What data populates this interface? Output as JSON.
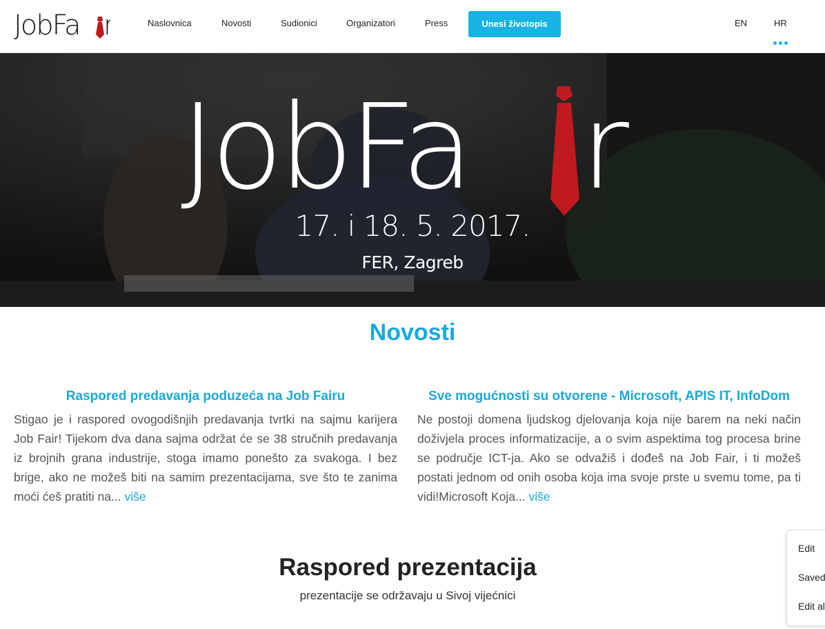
{
  "nav": {
    "logo": "JobFaır",
    "links": [
      "Naslovnica",
      "Novosti",
      "Sudionici",
      "Organizatori",
      "Press"
    ],
    "cta": "Unesi životopis",
    "languages": [
      "EN",
      "HR"
    ]
  },
  "hero": {
    "logo": "JobFair",
    "date": "17. i 18. 5. 2017.",
    "place": "FER, Zagreb"
  },
  "news": {
    "title": "Novosti",
    "items": [
      {
        "title": "Raspored predavanja poduzeća na Job Fairu",
        "body": "Stigao je i raspored ovogodišnjih predavanja tvrtki na sajmu karijera Job Fair! Tijekom dva dana sajma održat će se 38 stručnih predavanja iz brojnih grana industrije, stoga imamo ponešto za svakoga. I bez brige, ako ne možeš biti na samim prezentacijama, sve što te zanima moći ćeš pratiti na...",
        "more": "više"
      },
      {
        "title": "Sve mogućnosti su otvorene - Microsoft, APIS IT, InfoDom",
        "body": "Ne postoji domena ljudskog djelovanja koja nije barem na neki način doživjela proces informatizacije, a o svim aspektima tog procesa brine se područje ICT-ja. Ako se odvažiš i dođeš na Job Fair, i ti možeš postati jednom od onih osoba koja ima svoje prste u svemu tome, pa ti vidi!Microsoft Koja...",
        "more": "više"
      }
    ]
  },
  "schedule": {
    "title": "Raspored prezentacija",
    "subtitle": "prezentacije se održavaju u Sivoj vijećnici"
  },
  "side_panel": {
    "items": [
      "Edit",
      "Saved",
      "Edit al"
    ]
  },
  "colors": {
    "accent": "#17b3e4",
    "tie": "#c0191f"
  }
}
